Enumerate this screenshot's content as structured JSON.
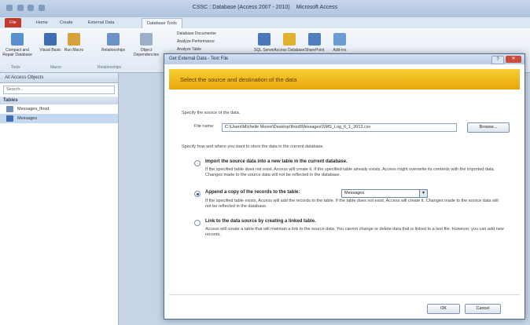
{
  "window": {
    "title": "CSSC : Database (Access 2007 - 2010)",
    "app": "Microsoft Access"
  },
  "tabs": [
    "File",
    "Home",
    "Create",
    "External Data",
    "Database Tools"
  ],
  "ribbon": {
    "buttons": [
      "Compact and Repair Database",
      "Visual Basic",
      "Run Macro",
      "Relationships",
      "Object Dependencies",
      "Database Documenter",
      "Analyze Performance",
      "Analyze Table",
      "SQL Server",
      "Access Database",
      "SharePoint",
      "Add-ins"
    ],
    "groups": [
      "Tools",
      "Macro",
      "Relationships"
    ]
  },
  "nav": {
    "header": "All Access Objects",
    "search_placeholder": "Search...",
    "section": "Tables",
    "items": [
      "Messages_Ifood",
      "Messages"
    ]
  },
  "dialog": {
    "title": "Get External Data - Text File",
    "banner": "Select the source and destination of the data",
    "source_label": "Specify the source of the data.",
    "filename_label": "File name:",
    "filename_value": "C:\\Users\\Michelle Moore\\Desktop\\Ifood\\Messages\\SMS_Log_6_1_2013.csv",
    "browse": "Browse...",
    "how_label": "Specify how and where you want to store the data in the current database.",
    "options": [
      {
        "title": "Import the source data into a new table in the current database.",
        "desc": "If the specified table does not exist, Access will create it. If the specified table already exists, Access might overwrite its contents with the imported data. Changes made to the source data will not be reflected in the database.",
        "selected": false
      },
      {
        "title": "Append a copy of the records to the table:",
        "desc": "If the specified table exists, Access will add the records to the table. If the table does not exist, Access will create it. Changes made to the source data will not be reflected in the database.",
        "selected": true
      },
      {
        "title": "Link to the data source by creating a linked table.",
        "desc": "Access will create a table that will maintain a link to the source data. You cannot change or delete data that is linked to a text file. However, you can add new records.",
        "selected": false
      }
    ],
    "append_table": "Messages",
    "ok": "OK",
    "cancel": "Cancel"
  },
  "colors": {
    "banner": "#f3b91f",
    "file_tab": "#c0392b",
    "close_button": "#c94c3d"
  }
}
